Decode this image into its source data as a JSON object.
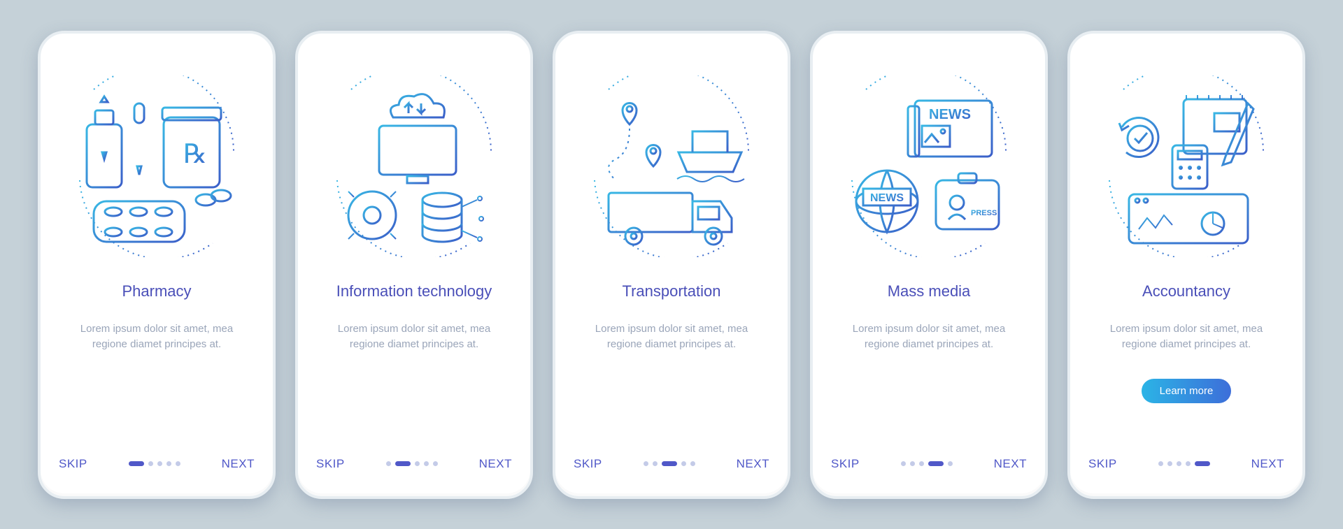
{
  "screens": [
    {
      "icon": "pharmacy-icon",
      "title": "Pharmacy",
      "desc": "Lorem ipsum dolor sit amet, mea regione diamet principes at.",
      "skip": "SKIP",
      "next": "NEXT",
      "cta": null,
      "activeDot": 0
    },
    {
      "icon": "it-icon",
      "title": "Information technology",
      "desc": "Lorem ipsum dolor sit amet, mea regione diamet principes at.",
      "skip": "SKIP",
      "next": "NEXT",
      "cta": null,
      "activeDot": 1
    },
    {
      "icon": "transportation-icon",
      "title": "Transportation",
      "desc": "Lorem ipsum dolor sit amet, mea regione diamet principes at.",
      "skip": "SKIP",
      "next": "NEXT",
      "cta": null,
      "activeDot": 2
    },
    {
      "icon": "massmedia-icon",
      "title": "Mass media",
      "desc": "Lorem ipsum dolor sit amet, mea regione diamet principes at.",
      "skip": "SKIP",
      "next": "NEXT",
      "cta": null,
      "activeDot": 3
    },
    {
      "icon": "accountancy-icon",
      "title": "Accountancy",
      "desc": "Lorem ipsum dolor sit amet, mea regione diamet principes at.",
      "skip": "SKIP",
      "next": "NEXT",
      "cta": "Learn more",
      "activeDot": 4
    }
  ],
  "colors": {
    "grad1": "#38b7e4",
    "grad2": "#3b5fc9"
  },
  "dotCount": 5
}
